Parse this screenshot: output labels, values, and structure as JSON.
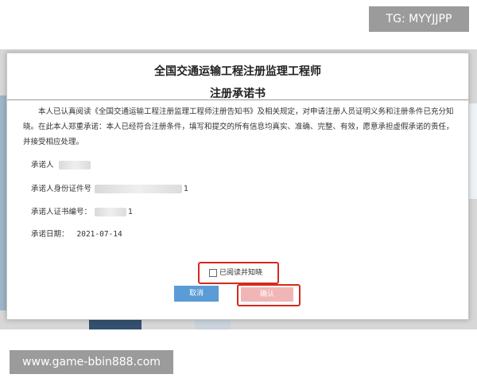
{
  "overlay": {
    "tg_text": "TG: MYYJJPP",
    "url_text": "www.game-bbin888.com"
  },
  "dialog": {
    "title_line1": "全国交通运输工程注册监理工程师",
    "title_line2": "注册承诺书",
    "body": "本人已认真阅读《全国交通运输工程注册监理工程师注册告知书》及相关规定，对申请注册人员证明义务和注册条件已充分知晓。在此本人郑重承诺：本人已经符合注册条件，填写和提交的所有信息均真实、准确、完整、有效，愿意承担虚假承诺的责任，并接受相应处理。",
    "fields": {
      "promisor_label": "承诺人",
      "id_label": "承诺人身份证件号",
      "id_suffix": "1",
      "cert_label": "承诺人证书编号：",
      "cert_suffix": "1",
      "date_label": "承诺日期：",
      "date_value": "2021-07-14"
    },
    "checkbox_label": "已阅读并知晓",
    "cancel_label": "取消",
    "confirm_label": "确认"
  }
}
